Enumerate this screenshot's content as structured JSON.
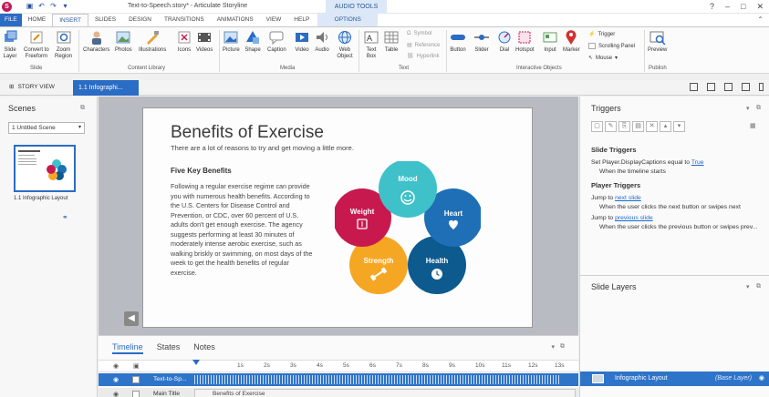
{
  "titlebar": {
    "app_letter": "S",
    "title": "Text-to-Speech.story* - Articulate Storyline",
    "contextual_tab": "AUDIO TOOLS"
  },
  "ribbon_tabs": [
    "FILE",
    "HOME",
    "INSERT",
    "SLIDES",
    "DESIGN",
    "TRANSITIONS",
    "ANIMATIONS",
    "VIEW",
    "HELP",
    "OPTIONS"
  ],
  "ribbon": {
    "slide_group": {
      "label": "Slide",
      "buttons": [
        {
          "l1": "Slide",
          "l2": "Layer"
        },
        {
          "l1": "Convert to",
          "l2": "Freeform"
        },
        {
          "l1": "Zoom",
          "l2": "Region"
        }
      ]
    },
    "content_group": {
      "label": "Content Library",
      "buttons": [
        "Characters",
        "Photos",
        "Illustrations",
        "Icons",
        "Videos"
      ]
    },
    "media_group": {
      "label": "Media",
      "buttons": [
        {
          "l1": "Picture",
          "l2": ""
        },
        {
          "l1": "Shape",
          "l2": ""
        },
        {
          "l1": "Caption",
          "l2": ""
        },
        {
          "l1": "Video",
          "l2": ""
        },
        {
          "l1": "Audio",
          "l2": ""
        },
        {
          "l1": "Web",
          "l2": "Object"
        }
      ]
    },
    "text_group": {
      "label": "Text",
      "buttons": [
        {
          "l1": "Text",
          "l2": "Box"
        },
        {
          "l1": "Table",
          "l2": ""
        }
      ],
      "small": [
        "Symbol",
        "Reference",
        "Hyperlink"
      ]
    },
    "interactive_group": {
      "label": "Interactive Objects",
      "buttons": [
        "Button",
        "Slider",
        "Dial",
        "Hotspot",
        "Input",
        "Marker"
      ],
      "small": [
        "Trigger",
        "Scrolling Panel",
        "Mouse"
      ]
    },
    "publish_group": {
      "label": "Publish",
      "button": "Preview"
    }
  },
  "tabstrip": {
    "story_view": "STORY VIEW",
    "slide_tab": "1.1 Infographi..."
  },
  "scenes": {
    "title": "Scenes",
    "selected_scene": "1 Untitled Scene",
    "thumb_caption": "1.1 Infographic Layout"
  },
  "slide": {
    "title": "Benefits of Exercise",
    "subtitle": "There are a lot of reasons to try and get moving a little more.",
    "heading": "Five Key Benefits",
    "body": "Following a regular exercise regime can provide you with numerous health benefits. According to the U.S. Centers for Disease Control and Prevention, or CDC, over 60 percent of U.S. adults don't get enough exercise. The agency suggests performing at least 30 minutes of moderately intense aerobic exercise, such as walking briskly or swimming, on most days of the week to get the health benefits of regular exercise.",
    "petals": [
      {
        "label": "Mood",
        "color": "#3fc1c9"
      },
      {
        "label": "Heart",
        "color": "#1e6fb6"
      },
      {
        "label": "Health",
        "color": "#0d5a8f"
      },
      {
        "label": "Strength",
        "color": "#f5a623"
      },
      {
        "label": "Weight",
        "color": "#c8194f"
      }
    ]
  },
  "timeline": {
    "tabs": [
      "Timeline",
      "States",
      "Notes"
    ],
    "ticks": [
      "1s",
      "2s",
      "3s",
      "4s",
      "5s",
      "6s",
      "7s",
      "8s",
      "9s",
      "10s",
      "11s",
      "12s",
      "13s",
      "14s"
    ],
    "rows": [
      {
        "name": "Text-to-Sp..."
      },
      {
        "name": "Main Title",
        "bar_label": "Benefits of Exercise"
      }
    ]
  },
  "triggers": {
    "title": "Triggers",
    "slide_triggers": "Slide Triggers",
    "t1_pre": "Set Player.DisplayCaptions equal to ",
    "t1_link": "True",
    "t1_when": "When the timeline starts",
    "player_triggers": "Player Triggers",
    "t2_pre": "Jump to ",
    "t2_link": "next slide",
    "t2_when": "When the user clicks the next button or swipes next",
    "t3_pre": "Jump to ",
    "t3_link": "previous slide",
    "t3_when": "When the user clicks the previous button or swipes prev..."
  },
  "layers": {
    "title": "Slide Layers",
    "base_name": "Infographic Layout",
    "base_tag": "(Base Layer)"
  }
}
